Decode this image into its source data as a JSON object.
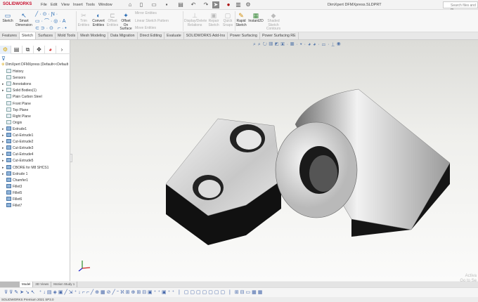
{
  "app": {
    "logo": "SOLIDWORKS",
    "title": "DimXpert DFMXpress.SLDPRT",
    "search_placeholder": "Search files and m"
  },
  "menu": [
    "File",
    "Edit",
    "View",
    "Insert",
    "Tools",
    "Window"
  ],
  "ribbon": {
    "sketch": "Sketch",
    "smart_dimension": "Smart Dimension",
    "trim": "Trim Entities",
    "convert": "Convert Entities",
    "offset": "Offset Entities",
    "offset_surface": "Offset On Surface",
    "mirror": "Mirror Entities",
    "linear_pattern": "Linear Sketch Pattern",
    "move": "Move Entities",
    "display_delete": "Display/Delete Relations",
    "repair": "Repair Sketch",
    "quick_snaps": "Quick Snaps",
    "rapid": "Rapid Sketch",
    "instant2d": "Instant2D",
    "shaded": "Shaded Sketch Contours"
  },
  "tabs": [
    {
      "label": "Features"
    },
    {
      "label": "Sketch",
      "active": true
    },
    {
      "label": "Surfaces"
    },
    {
      "label": "Mold Tools"
    },
    {
      "label": "Mesh Modeling"
    },
    {
      "label": "Data Migration"
    },
    {
      "label": "Direct Editing"
    },
    {
      "label": "Evaluate"
    },
    {
      "label": "SOLIDWORKS Add-Ins"
    },
    {
      "label": "Power Surfacing"
    },
    {
      "label": "Power Surfacing RE"
    }
  ],
  "tree": {
    "root": "DimXpert DFMXpress  (Default<<Default",
    "items": [
      {
        "label": "History",
        "expand": false,
        "type": "folder"
      },
      {
        "label": "Sensors",
        "expand": false,
        "type": "folder"
      },
      {
        "label": "Annotations",
        "expand": true,
        "type": "folder"
      },
      {
        "label": "Solid Bodies(1)",
        "expand": true,
        "type": "folder"
      },
      {
        "label": "Plain Carbon Steel",
        "expand": false,
        "type": "material"
      },
      {
        "label": "Front Plane",
        "expand": false,
        "type": "plane"
      },
      {
        "label": "Top Plane",
        "expand": false,
        "type": "plane"
      },
      {
        "label": "Right Plane",
        "expand": false,
        "type": "plane"
      },
      {
        "label": "Origin",
        "expand": false,
        "type": "origin"
      },
      {
        "label": "Extrude1",
        "expand": true,
        "type": "feat"
      },
      {
        "label": "Cut-Extrude1",
        "expand": true,
        "type": "feat"
      },
      {
        "label": "Cut-Extrude2",
        "expand": true,
        "type": "feat"
      },
      {
        "label": "Cut-Extrude3",
        "expand": true,
        "type": "feat"
      },
      {
        "label": "Cut-Extrude4",
        "expand": true,
        "type": "feat"
      },
      {
        "label": "Cut-Extrude5",
        "expand": true,
        "type": "feat"
      },
      {
        "label": "CBORE for M8 SHCS1",
        "expand": true,
        "type": "feat"
      },
      {
        "label": "Extrude 1",
        "expand": true,
        "type": "feat"
      },
      {
        "label": "Chamfer1",
        "expand": false,
        "type": "feat"
      },
      {
        "label": "Fillet3",
        "expand": false,
        "type": "feat"
      },
      {
        "label": "Fillet5",
        "expand": false,
        "type": "feat"
      },
      {
        "label": "Fillet6",
        "expand": false,
        "type": "feat"
      },
      {
        "label": "Fillet7",
        "expand": false,
        "type": "feat"
      }
    ]
  },
  "bottom_tabs": [
    {
      "label": "Model",
      "active": true
    },
    {
      "label": "3D Views"
    },
    {
      "label": "Motion Study 1"
    }
  ],
  "status": "SOLIDWORKS Premium 2021 SP3.0",
  "watermark": {
    "line1": "Activa",
    "line2": "Go to Se"
  },
  "colors": {
    "brand": "#c8102e",
    "accent": "#2a6db5"
  }
}
